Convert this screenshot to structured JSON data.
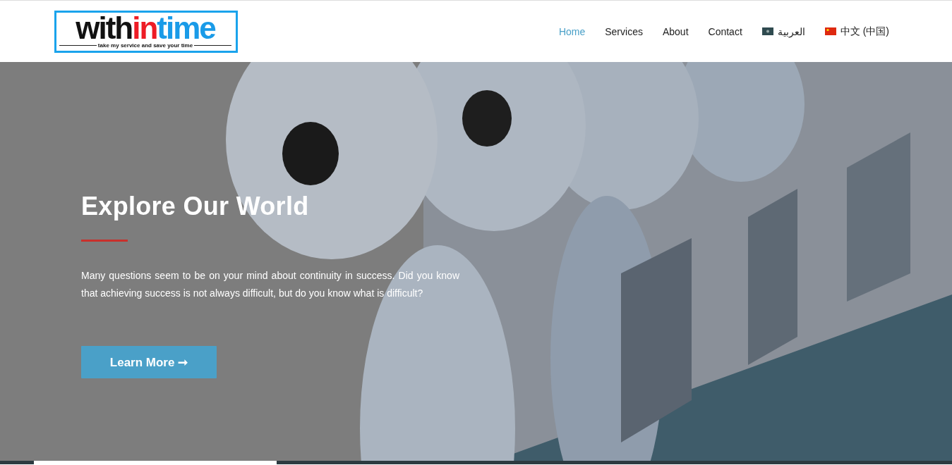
{
  "header": {
    "logo": {
      "parts": [
        {
          "text": "with",
          "color": "#111111"
        },
        {
          "text": "in",
          "color": "#ee1c25"
        },
        {
          "text": "time",
          "color": "#1a9be8"
        }
      ],
      "tagline": "take my service and save your time"
    },
    "nav": [
      {
        "label": "Home",
        "selected": true,
        "kind": "link"
      },
      {
        "label": "Services",
        "selected": false,
        "kind": "link"
      },
      {
        "label": "About",
        "selected": false,
        "kind": "link"
      },
      {
        "label": "Contact",
        "selected": false,
        "kind": "link"
      },
      {
        "label": "العربية",
        "selected": false,
        "kind": "language"
      },
      {
        "label": "中文 (中国)",
        "selected": false,
        "kind": "language"
      }
    ]
  },
  "hero": {
    "title": "Explore Our World",
    "text": "Many questions seem to be on your mind about continuity in success. Did you know that achieving success is not always difficult, but do you know what is difficult?",
    "button": "Learn More ➞"
  }
}
